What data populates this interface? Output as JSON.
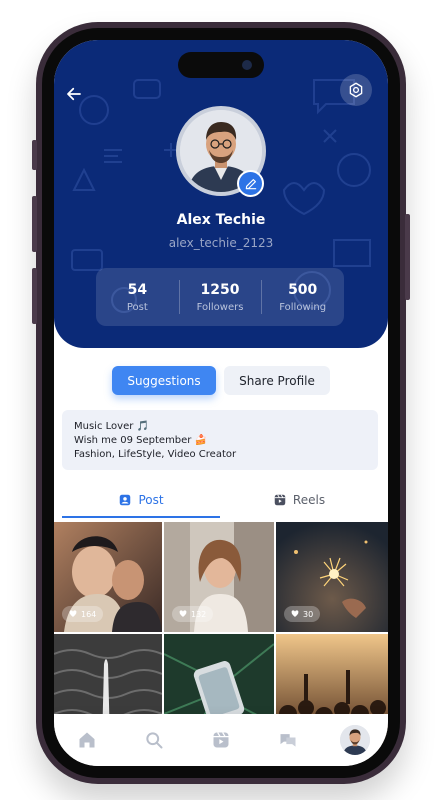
{
  "header": {
    "back_icon": "arrow-left-icon",
    "settings_icon": "gear-icon",
    "background_color": "#0b2a78"
  },
  "profile": {
    "name": "Alex Techie",
    "username": "alex_techie_2123",
    "edit_icon": "pencil-icon",
    "stats": [
      {
        "value": "54",
        "label": "Post"
      },
      {
        "value": "1250",
        "label": "Followers"
      },
      {
        "value": "500",
        "label": "Following"
      }
    ]
  },
  "actions": {
    "suggestions_label": "Suggestions",
    "share_label": "Share Profile",
    "accent_color": "#3f86f2"
  },
  "bio": {
    "lines": [
      "Music Lover 🎵",
      "Wish me 09 September 🍰",
      "Fashion, LifeStyle, Video Creator"
    ]
  },
  "tabs": [
    {
      "label": "Post",
      "icon": "post-icon",
      "active": true
    },
    {
      "label": "Reels",
      "icon": "reels-icon",
      "active": false
    }
  ],
  "posts": [
    {
      "likes": "164"
    },
    {
      "likes": "132"
    },
    {
      "likes": "30"
    },
    {
      "likes": ""
    },
    {
      "likes": ""
    },
    {
      "likes": ""
    }
  ],
  "bottom_nav": {
    "items": [
      "home-icon",
      "search-icon",
      "reels-icon",
      "chat-icon",
      "profile-avatar"
    ]
  }
}
